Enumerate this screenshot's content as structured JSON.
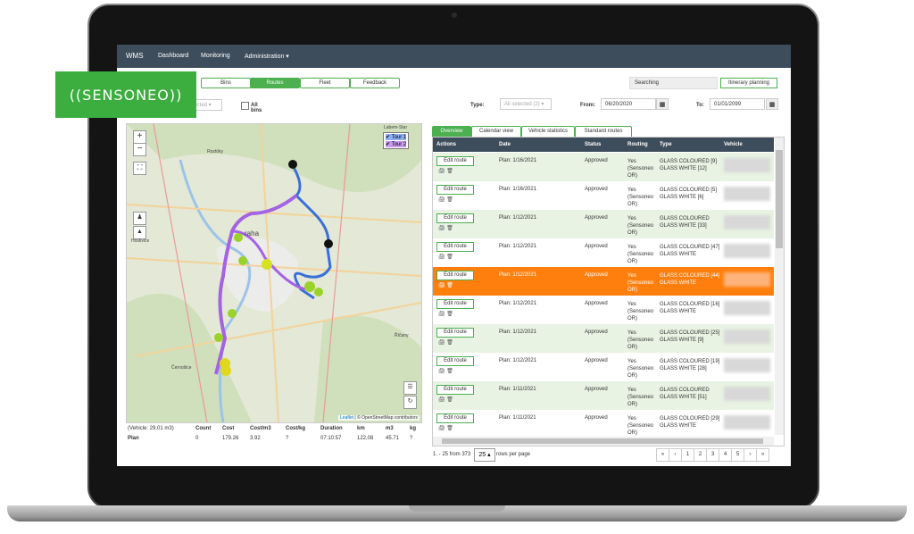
{
  "brand_logo": "((SENSONEO))",
  "app": {
    "name": "WMS"
  },
  "nav": [
    "Dashboard",
    "Monitoring",
    "Administration ▾"
  ],
  "subtabs": [
    "Bins",
    "Routes",
    "Fleet",
    "Feedback"
  ],
  "searching_label": "Searching",
  "itinerary_button": "Itinerary planning",
  "filters": {
    "selected_stub": "lected ▾",
    "all_bins_label": "All bins",
    "type_label": "Type:",
    "type_value": "All selected (2) ▾",
    "from_label": "From:",
    "from_value": "06/20/2020",
    "to_label": "To:",
    "to_value": "01/01/2099"
  },
  "map": {
    "zoom_in": "+",
    "zoom_out": "−",
    "fullscreen": "⛶",
    "legend": [
      "Tour 1",
      "Tour 2"
    ],
    "attribution_leaflet": "Leaflet",
    "attribution_rest": " | © OpenStreetMap contributors",
    "place_labels": [
      "Roztóky",
      "raha",
      "Hostivice",
      "Černošice",
      "Říčany",
      "Labem-Star"
    ],
    "route_colors": {
      "tour1": "#3a6fd8",
      "tour2": "#a463e3"
    }
  },
  "summary": {
    "vehicle_label": "(Vehicle: 29.01 m3)",
    "headers": [
      "Count",
      "Cost",
      "Cost/m3",
      "Cost/kg",
      "Duration",
      "km",
      "m3",
      "kg"
    ],
    "plan_label": "Plan",
    "values": [
      "0",
      "179.26",
      "3.92",
      "?",
      "07:10:57",
      "122,08",
      "45.71",
      "?"
    ]
  },
  "right_tabs": [
    "Overview",
    "Calendar view",
    "Vehicle statistics",
    "Standard routes"
  ],
  "grid": {
    "columns": [
      "Actions",
      "Date",
      "Status",
      "Routing",
      "Type",
      "Vehicle"
    ],
    "edit_label": "Edit route",
    "action_icons": "🖨 🗑",
    "rows": [
      {
        "date": "Plan: 1/16/2021",
        "status": "Approved",
        "routing": "Yes (Sensoneo OR)",
        "type": "GLASS COLOURED [9] GLASS WHITE [12]",
        "highlight": false
      },
      {
        "date": "Plan: 1/16/2021",
        "status": "Approved",
        "routing": "Yes (Sensoneo OR)",
        "type": "GLASS COLOURED [5] GLASS WHITE [6]",
        "highlight": false
      },
      {
        "date": "Plan: 1/12/2021",
        "status": "Approved",
        "routing": "Yes (Sensoneo OR)",
        "type": "GLASS COLOURED GLASS WHITE [33]",
        "highlight": false
      },
      {
        "date": "Plan: 1/12/2021",
        "status": "Approved",
        "routing": "Yes (Sensoneo OR)",
        "type": "GLASS COLOURED [47] GLASS WHITE",
        "highlight": false
      },
      {
        "date": "Plan: 1/12/2021",
        "status": "Approved",
        "routing": "Yes (Sensoneo OR)",
        "type": "GLASS COLOURED [44] GLASS WHITE",
        "highlight": true
      },
      {
        "date": "Plan: 1/12/2021",
        "status": "Approved",
        "routing": "Yes (Sensoneo OR)",
        "type": "GLASS COLOURED [16] GLASS WHITE",
        "highlight": false
      },
      {
        "date": "Plan: 1/12/2021",
        "status": "Approved",
        "routing": "Yes (Sensoneo OR)",
        "type": "GLASS COLOURED [25] GLASS WHITE [9]",
        "highlight": false
      },
      {
        "date": "Plan: 1/12/2021",
        "status": "Approved",
        "routing": "Yes (Sensoneo OR)",
        "type": "GLASS COLOURED [19] GLASS WHITE [28]",
        "highlight": false
      },
      {
        "date": "Plan: 1/11/2021",
        "status": "Approved",
        "routing": "Yes (Sensoneo OR)",
        "type": "GLASS COLOURED GLASS WHITE [51]",
        "highlight": false
      },
      {
        "date": "Plan: 1/11/2021",
        "status": "Approved",
        "routing": "Yes (Sensoneo OR)",
        "type": "GLASS COLOURED [29] GLASS WHITE",
        "highlight": false
      }
    ]
  },
  "pagination": {
    "range": "1. - 25 from 373",
    "page_size": "25 ▴",
    "per_page_label": "rows per page",
    "buttons": [
      "«",
      "‹",
      "1",
      "2",
      "3",
      "4",
      "5",
      "›",
      "»"
    ]
  },
  "colors": {
    "accent": "#4caf50",
    "navbar": "#3e4d5c",
    "highlight_row": "#ff7f0e",
    "row_bg": "#e8f3e3",
    "brand": "#3cae3f"
  }
}
